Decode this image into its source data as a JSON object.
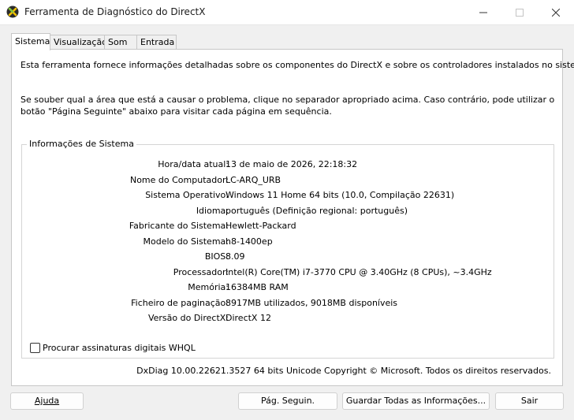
{
  "window": {
    "title": "Ferramenta de Diagnóstico do DirectX"
  },
  "tabs": [
    {
      "label": "Sistema",
      "active": true
    },
    {
      "label": "Visualização",
      "active": false
    },
    {
      "label": "Som",
      "active": false
    },
    {
      "label": "Entrada",
      "active": false
    }
  ],
  "intro": {
    "line1": "Esta ferramenta fornece informações detalhadas sobre os componentes do DirectX e sobre os controladores instalados no sistema.",
    "line2": "Se souber qual a área que está a causar o problema, clique no separador apropriado acima. Caso contrário, pode utilizar o botão \"Página Seguinte\" abaixo para visitar cada página em sequência."
  },
  "system_info": {
    "group_title": "Informações de Sistema",
    "rows": [
      {
        "label": "Hora/data atual:",
        "value": "13 de maio de 2026, 22:18:32"
      },
      {
        "label": "Nome do Computador:",
        "value": "LC-ARQ_URB"
      },
      {
        "label": "Sistema Operativo:",
        "value": "Windows 11 Home 64 bits (10.0, Compilação 22631)"
      },
      {
        "label": "Idioma:",
        "value": "português (Definição regional: português)"
      },
      {
        "label": "Fabricante do Sistema:",
        "value": "Hewlett-Packard"
      },
      {
        "label": "Modelo do Sistema:",
        "value": "h8-1400ep"
      },
      {
        "label": "BIOS:",
        "value": "8.09"
      },
      {
        "label": "Processador:",
        "value": "Intel(R) Core(TM) i7-3770 CPU @ 3.40GHz (8 CPUs), ~3.4GHz"
      },
      {
        "label": "Memória:",
        "value": "16384MB RAM"
      },
      {
        "label": "Ficheiro de paginação:",
        "value": "8917MB utilizados, 9018MB disponíveis"
      },
      {
        "label": "Versão do DirectX:",
        "value": "DirectX 12"
      }
    ],
    "whql_checkbox": {
      "label": "Procurar assinaturas digitais WHQL",
      "checked": false
    }
  },
  "copyright": "DxDiag 10.00.22621.3527 64 bits Unicode Copyright © Microsoft. Todos os direitos reservados.",
  "buttons": {
    "help": "Ajuda",
    "next_page": "Pág. Seguin.",
    "save_all": "Guardar Todas as Informações...",
    "exit": "Sair"
  },
  "icons": {
    "app": "directx-icon",
    "minimize": "minimize-icon",
    "maximize": "maximize-icon",
    "close": "close-icon"
  },
  "colors": {
    "window_bg": "#f0f0f0",
    "panel_bg": "#ffffff",
    "border": "#c7c7c7"
  }
}
